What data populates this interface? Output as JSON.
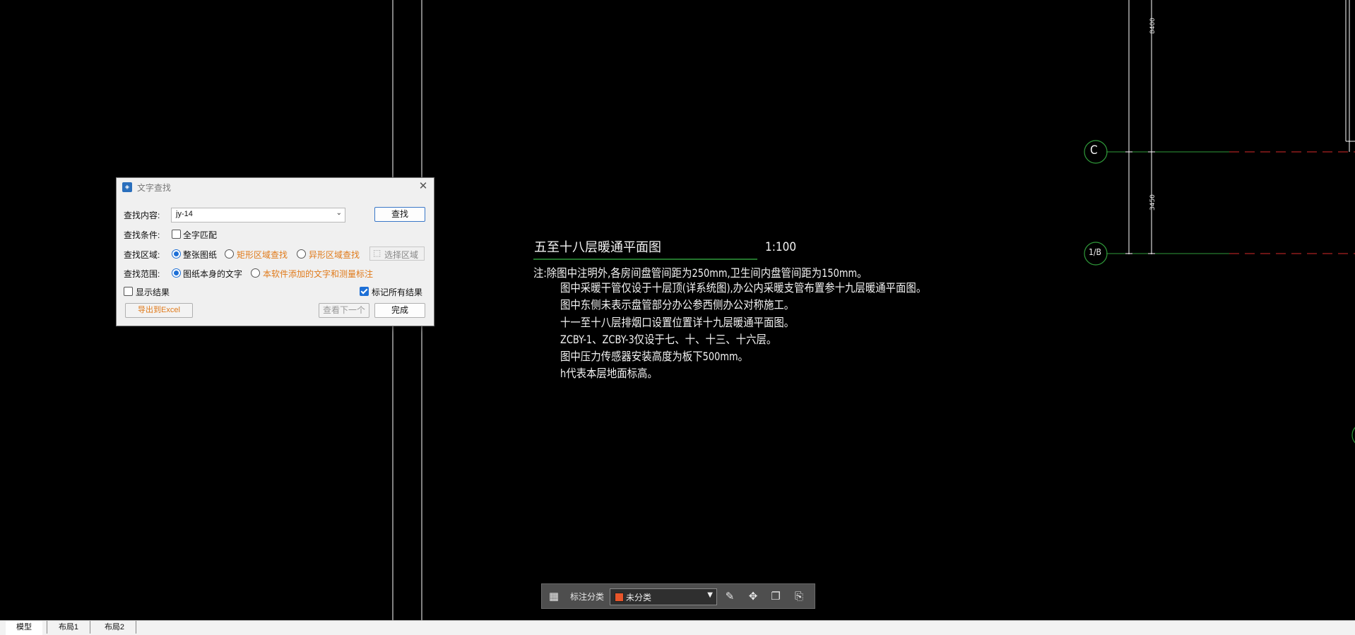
{
  "drawing": {
    "plan_title": "五至十八层暖通平面图",
    "plan_scale": "1:100",
    "notes": [
      "注:除图中注明外,各房间盘管间距为250mm,卫生间内盘管间距为150mm。",
      "图中采暖干管仅设于十层顶(详系统图),办公内采暖支管布置参十九层暖通平面图。",
      "图中东侧未表示盘管部分办公参西侧办公对称施工。",
      "十一至十八层排烟口设置位置详十九层暖通平面图。",
      "ZCBY-1、ZCBY-3仅设于七、十、十三、十六层。",
      "图中压力传感器安装高度为板下500mm。",
      "h代表本层地面标高。"
    ],
    "grid_bubbles": [
      "C",
      "1/B"
    ],
    "dimensions": [
      "8400",
      "3450"
    ],
    "colors": {
      "background": "#000000",
      "linework": "#ffffff",
      "grid_lines": "#2f9a3a",
      "dashed_lines": "#d62a2a"
    }
  },
  "dialog": {
    "title": "文字查找",
    "close_icon": "close-icon",
    "search_content_label": "查找内容:",
    "search_content_value": "jy-14",
    "find_button": "查找",
    "condition_label": "查找条件:",
    "whole_word_label": "全字匹配",
    "whole_word_checked": false,
    "area_label": "查找区域:",
    "area_options": [
      "整张图纸",
      "矩形区域查找",
      "异形区域查找"
    ],
    "area_selected": "整张图纸",
    "select_area_button": "选择区域",
    "scope_label": "查找范围:",
    "scope_options": [
      "图纸本身的文字",
      "本软件添加的文字和测量标注"
    ],
    "scope_selected": "图纸本身的文字",
    "show_results_label": "显示结果",
    "show_results_checked": false,
    "mark_all_label": "标记所有结果",
    "mark_all_checked": true,
    "export_button": "导出到Excel",
    "next_button": "查看下一个",
    "done_button": "完成"
  },
  "annotation_toolbar": {
    "grid_icon": "grid-icon",
    "category_label": "标注分类",
    "category_value": "未分类",
    "category_color": "#e8552a",
    "tools": [
      "edit-icon",
      "move-icon",
      "copy-icon",
      "paste-icon"
    ]
  },
  "layout_tabs": [
    "模型",
    "布局1",
    "布局2"
  ],
  "active_tab": "模型"
}
